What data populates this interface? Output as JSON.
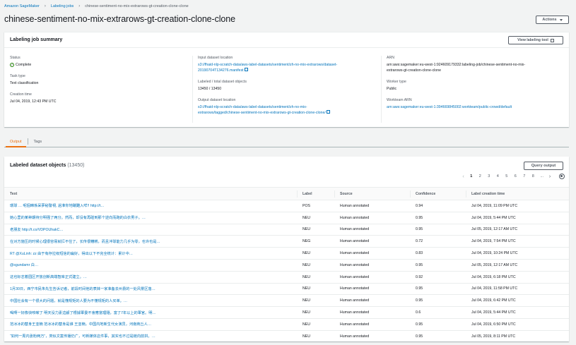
{
  "breadcrumb": {
    "items": [
      "Amazon SageMaker",
      "Labeling jobs"
    ],
    "current": "chinese-sentiment-no-mix-extrarows-gt-creation-clone-clone"
  },
  "page": {
    "title": "chinese-sentiment-no-mix-extrarows-gt-creation-clone-clone",
    "actions_label": "Actions"
  },
  "summary": {
    "title": "Labeling job summary",
    "view_tool_label": "View labeling tool",
    "status_label": "Status",
    "status_value": "Complete",
    "task_type_label": "Task type",
    "task_type_value": "Text classification",
    "creation_time_label": "Creation time",
    "creation_time_value": "Jul 04, 2019, 12:43 PM UTC",
    "input_label": "Input dataset location",
    "input_value_1": "s3://fhaid-nlp-scratch-data/aws-label-datasets/sentiment/zh-no-mix-extrarows/dataset-",
    "input_value_2": "20190704T134276.manifest",
    "labeled_label": "Labeled / total dataset objects",
    "labeled_value": "13450 / 13450",
    "output_label": "Output dataset location",
    "output_value_1": "s3://fhaid-nlp-scratch-data/aws-label-datasets/sentiment/zh-no-mix-",
    "output_value_2": "extrarows/tagged/chinese-sentiment-no-mix-extrarows-gt-creation-clone-clone/",
    "arn_label": "ARN",
    "arn_value_1": "arn:aws:sagemaker:eu-west-1:924609179332:labeling-job/chinese-sentiment-no-mix-",
    "arn_value_2": "extrarows-gt-creation-clone-clone",
    "worker_type_label": "Worker type",
    "worker_type_value": "Public",
    "workteam_label": "Workteam ARN",
    "workteam_value": "arn:aws:sagemaker:eu-west-1:394669845002:workteam/public-crowd/default"
  },
  "tabs": [
    {
      "label": "Output",
      "active": true
    },
    {
      "label": "Tags",
      "active": false
    }
  ],
  "dataset": {
    "title": "Labeled dataset objects",
    "count": "(13450)",
    "query_label": "Query output",
    "pages": [
      "1",
      "2",
      "3",
      "4",
      "5",
      "6",
      "7",
      "8",
      "..."
    ],
    "columns": [
      "Text",
      "Label",
      "Source",
      "Confidence",
      "Label creation time"
    ],
    "rows": [
      [
        "環球 …  呢個睇係呆夢秘警視, 過准你地踹難入咩!! http://t…",
        "POS",
        "Human annotated",
        "0.94",
        "Jul 04, 2019, 11:09 PM UTC"
      ],
      [
        "她心里的某种期待分明强了两分。然而，却没有再碰到那个逆向而跑的白衣男子。…",
        "NEU",
        "Human annotated",
        "0.95",
        "Jul 04, 2019, 5:44 PM UTC"
      ],
      [
        "老朋友 http://t.co/VDPOUhakC…",
        "NEU",
        "Human annotated",
        "0.95",
        "Jul 05, 2019, 12:17 AM UTC"
      ],
      [
        "在对方施压的时候心理很容易就扛不住了，长传很糟糕，而且冲球能力几乎为零，也许也是…",
        "NEG",
        "Human annotated",
        "0.72",
        "Jul 04, 2019, 7:54 PM UTC"
      ],
      [
        "RT @XuLinh: zz 由于有存拉级短信的扁好，得出以下不完全统计：累计中…",
        "NEU",
        "Human annotated",
        "0.83",
        "Jul 04, 2019, 10:24 PM UTC"
      ],
      [
        "@sgundamr 白…",
        "NEU",
        "Human annotated",
        "0.95",
        "Jul 05, 2019, 12:17 AM UTC"
      ],
      [
        "这也标志着园区开放创新高端智库正式建立。…",
        "NEU",
        "Human annotated",
        "0.92",
        "Jul 04, 2019, 6:18 PM UTC"
      ],
      [
        "1月30日，西宁市民朱先生告诉记者，前段时间他的表妹一家准备去州县的一处风景区落…",
        "NEU",
        "Human annotated",
        "0.95",
        "Jul 04, 2019, 11:58 PM UTC"
      ],
      [
        "中国社会有一个很大的问题，就是懂规矩的人要为不懂规矩的人买单。…",
        "NEU",
        "Human annotated",
        "0.95",
        "Jul 04, 2019, 6:42 PM UTC"
      ],
      [
        "喝啊一好像快咳嗽了 明天没力素這顧了根據軍委不會應當理隨，富了7年以上的軍官。明…",
        "NEU",
        "Human annotated",
        "0.6",
        "Jul 04, 2019, 5:44 PM UTC"
      ],
      [
        "范冰冰的替身王亚楠 范冰冰的替身是谁 王亚楠，中国内地新生代女演员，河南商丘人…",
        "NEU",
        "Human annotated",
        "0.95",
        "Jul 04, 2019, 6:50 PM UTC"
      ],
      [
        "“如何一周内涨粉两万”，类似文案传播仍广，可新媒体这件事，其实也不过是链向前拱。…",
        "NEU",
        "Human annotated",
        "0.95",
        "Jul 05, 2019, 8:11 PM UTC"
      ]
    ]
  }
}
